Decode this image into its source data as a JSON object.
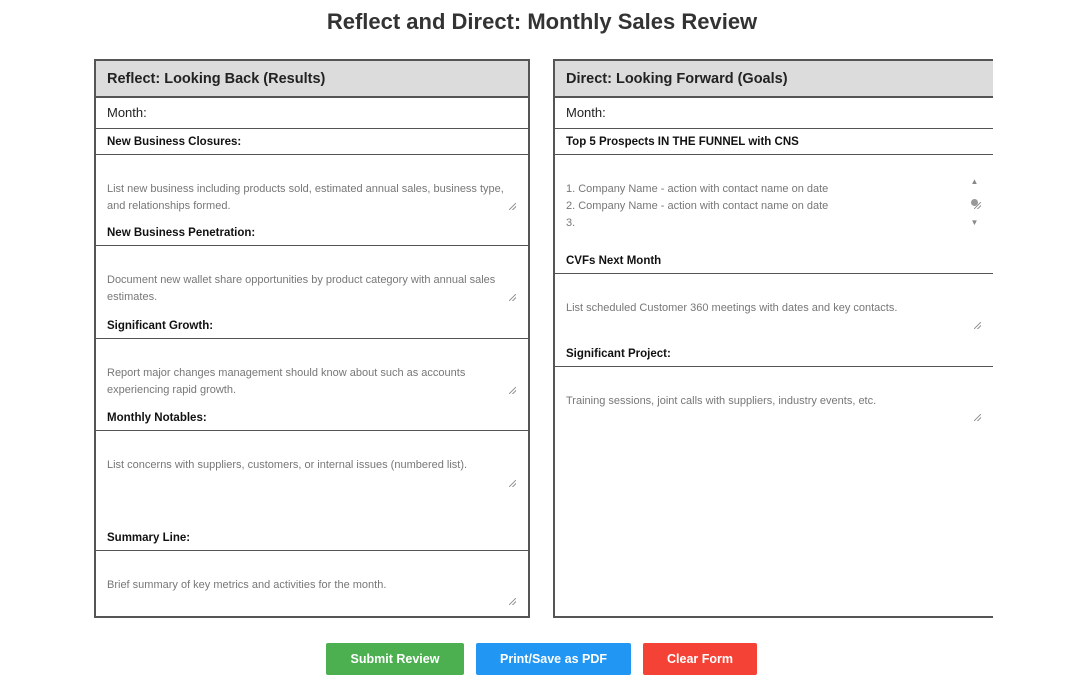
{
  "title": "Reflect and Direct: Monthly Sales Review",
  "reflect": {
    "header": "Reflect: Looking Back (Results)",
    "month_label": "Month:",
    "sections": [
      {
        "label": "New Business Closures:",
        "placeholder": "List new business including products sold, estimated annual sales, business type, and relationships formed."
      },
      {
        "label": "New Business Penetration:",
        "placeholder": "Document new wallet share opportunities by product category with annual sales estimates."
      },
      {
        "label": "Significant Growth:",
        "placeholder": "Report major changes management should know about such as accounts experiencing rapid growth."
      },
      {
        "label": "Monthly Notables:",
        "placeholder": "List concerns with suppliers, customers, or internal issues (numbered list)."
      },
      {
        "label": "Summary Line:",
        "placeholder": "Brief summary of key metrics and activities for the month."
      }
    ]
  },
  "direct": {
    "header": "Direct: Looking Forward (Goals)",
    "month_label": "Month:",
    "sections": [
      {
        "label": "Top 5 Prospects IN THE FUNNEL with CNS",
        "placeholder": "1. Company Name - action with contact name on date\n2. Company Name - action with contact name on date\n3."
      },
      {
        "label": "CVFs Next Month",
        "placeholder": "List scheduled Customer 360 meetings with dates and key contacts."
      },
      {
        "label": "Significant Project:",
        "placeholder": "Training sessions, joint calls with suppliers, industry events, etc."
      }
    ]
  },
  "buttons": {
    "submit": "Submit Review",
    "print": "Print/Save as PDF",
    "clear": "Clear Form"
  },
  "colors": {
    "submit": "#4caf50",
    "print": "#2196f3",
    "clear": "#f44336",
    "header_bg": "#dcdcdc"
  }
}
